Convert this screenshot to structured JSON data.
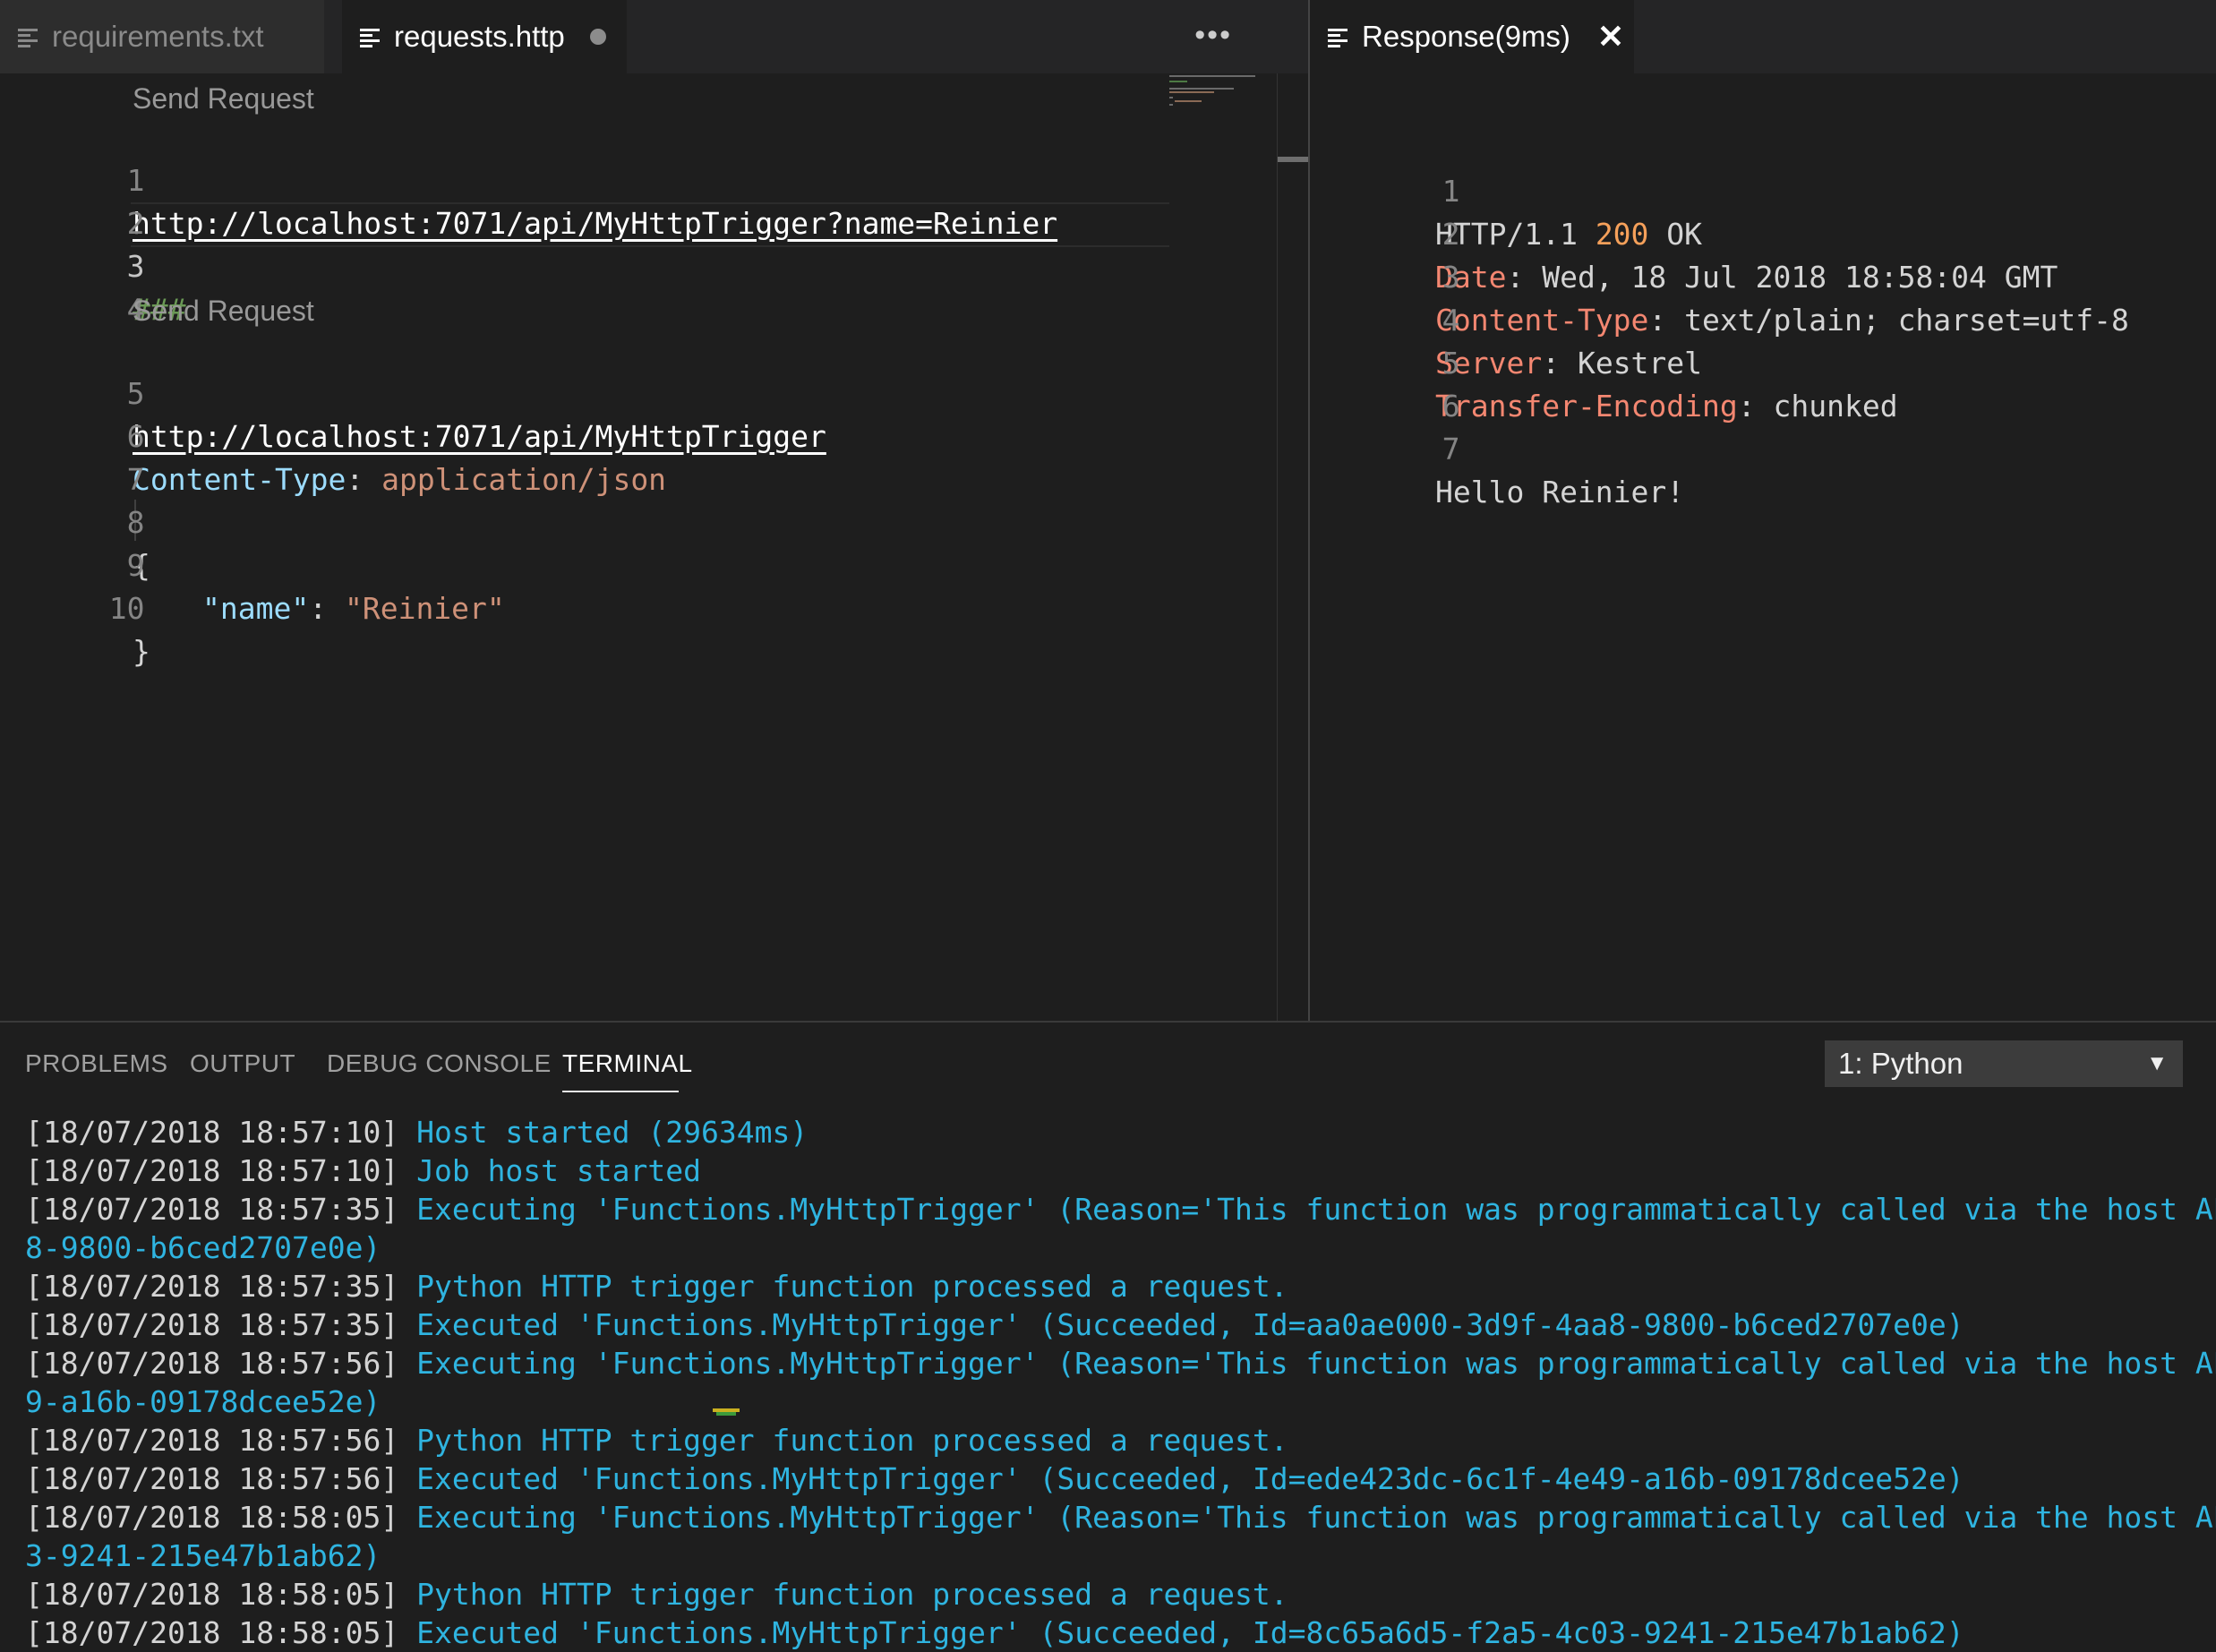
{
  "editor": {
    "tabs": [
      {
        "label": "requirements.txt",
        "active": false
      },
      {
        "label": "requests.http",
        "active": true,
        "dirty": true
      }
    ],
    "more_icon": "ellipsis-icon",
    "codelens_1": "Send Request",
    "codelens_2": "Send Request",
    "line_numbers": [
      "1",
      "2",
      "3",
      "4",
      "5",
      "6",
      "7",
      "8",
      "9",
      "10"
    ],
    "lines": {
      "l1_url": "http://localhost:7071/api/MyHttpTrigger?name=Reinier",
      "l3_comment": "###",
      "l5_url": "http://localhost:7071/api/MyHttpTrigger",
      "l6_header_name": "Content-Type",
      "l6_colon": ":",
      "l6_header_value": "application/json",
      "l8": "{",
      "l9_key": "\"name\"",
      "l9_colon": ": ",
      "l9_value": "\"Reinier\"",
      "l10": "}"
    }
  },
  "response": {
    "tab_label": "Response(9ms)",
    "close_icon": "close-icon",
    "line_numbers": [
      "1",
      "2",
      "3",
      "4",
      "5",
      "6",
      "7"
    ],
    "status_prefix": "HTTP/1.1 ",
    "status_code": "200",
    "status_text": " OK",
    "headers": [
      {
        "name": "Date",
        "value": ": Wed, 18 Jul 2018 18:58:04 GMT"
      },
      {
        "name": "Content-Type",
        "value": ": text/plain; charset=utf-8"
      },
      {
        "name": "Server",
        "value": ": Kestrel"
      },
      {
        "name": "Transfer-Encoding",
        "value": ": chunked"
      }
    ],
    "body": "Hello Reinier!"
  },
  "panel": {
    "tabs": [
      "PROBLEMS",
      "OUTPUT",
      "DEBUG CONSOLE",
      "TERMINAL"
    ],
    "active_tab": "TERMINAL",
    "terminal_select": "1: Python",
    "terminal_lines": [
      {
        "ts": "[18/07/2018 18:57:10] ",
        "msg": "Host started (29634ms)"
      },
      {
        "ts": "[18/07/2018 18:57:10] ",
        "msg": "Job host started"
      },
      {
        "ts": "[18/07/2018 18:57:35] ",
        "msg": "Executing 'Functions.MyHttpTrigger' (Reason='This function was programmatically called via the host APIs.',"
      },
      {
        "ts": "",
        "msg": "8-9800-b6ced2707e0e)"
      },
      {
        "ts": "[18/07/2018 18:57:35] ",
        "msg": "Python HTTP trigger function processed a request."
      },
      {
        "ts": "[18/07/2018 18:57:35] ",
        "msg": "Executed 'Functions.MyHttpTrigger' (Succeeded, Id=aa0ae000-3d9f-4aa8-9800-b6ced2707e0e)"
      },
      {
        "ts": "[18/07/2018 18:57:56] ",
        "msg": "Executing 'Functions.MyHttpTrigger' (Reason='This function was programmatically called via the host APIs.',"
      },
      {
        "ts": "",
        "msg": "9-a16b-09178dcee52e)"
      },
      {
        "ts": "[18/07/2018 18:57:56] ",
        "msg": "Python HTTP trigger function processed a request."
      },
      {
        "ts": "[18/07/2018 18:57:56] ",
        "msg": "Executed 'Functions.MyHttpTrigger' (Succeeded, Id=ede423dc-6c1f-4e49-a16b-09178dcee52e)"
      },
      {
        "ts": "[18/07/2018 18:58:05] ",
        "msg": "Executing 'Functions.MyHttpTrigger' (Reason='This function was programmatically called via the host APIs.',"
      },
      {
        "ts": "",
        "msg": "3-9241-215e47b1ab62)"
      },
      {
        "ts": "[18/07/2018 18:58:05] ",
        "msg": "Python HTTP trigger function processed a request."
      },
      {
        "ts": "[18/07/2018 18:58:05] ",
        "msg": "Executed 'Functions.MyHttpTrigger' (Succeeded, Id=8c65a6d5-f2a5-4c03-9241-215e47b1ab62)"
      }
    ]
  },
  "colors": {
    "background": "#1e1e1e",
    "tab_bar": "#252526",
    "terminal_message": "#2fb4e0",
    "header_name": "#f48771",
    "status_code": "#f5a05a"
  }
}
